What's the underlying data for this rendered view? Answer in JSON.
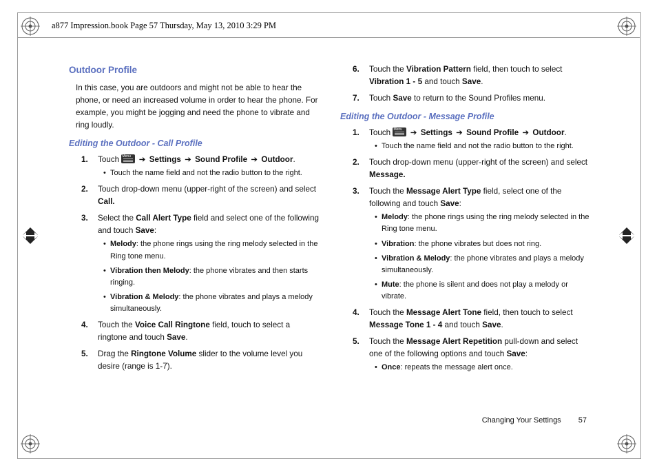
{
  "header": "a877 Impression.book  Page 57  Thursday, May 13, 2010  3:29 PM",
  "section_title": "Outdoor Profile",
  "intro": "In this case, you are outdoors and might not be able to hear the phone, or need an increased volume in order to hear the phone. For example, you might be jogging and need the phone to vibrate and ring loudly.",
  "sub1_title": "Editing the Outdoor - Call Profile",
  "sub2_title": "Editing the Outdoor - Message Profile",
  "nav_path": "Settings ➔ Sound Profile ➔ Outdoor",
  "arrow": "➔",
  "steps1": {
    "s1_a": "Touch ",
    "s1_b": "Settings",
    "s1_c": "Sound Profile",
    "s1_d": "Outdoor",
    "s1_note": "Touch the name field and not the radio button to the right.",
    "s2_a": "Touch drop-down menu (upper-right of the screen) and select ",
    "s2_b": "Call.",
    "s3_a": "Select the ",
    "s3_b": "Call Alert Type",
    "s3_c": " field and select one of the following and touch ",
    "s3_d": "Save",
    "s3_opts": {
      "o1a": "Melody",
      "o1b": ": the phone rings using the ring melody selected in the Ring tone menu.",
      "o2a": "Vibration then Melody",
      "o2b": ": the phone vibrates and then starts ringing.",
      "o3a": "Vibration & Melody",
      "o3b": ": the phone vibrates and plays a melody simultaneously."
    },
    "s4_a": "Touch the ",
    "s4_b": "Voice Call Ringtone",
    "s4_c": " field, touch to select a ringtone and touch ",
    "s4_d": "Save",
    "s5_a": "Drag the ",
    "s5_b": "Ringtone Volume",
    "s5_c": " slider to the volume level you desire (range is 1-7).",
    "s6_a": "Touch the ",
    "s6_b": "Vibration Pattern",
    "s6_c": " field, then touch to select ",
    "s6_d": "Vibration 1 - 5",
    "s6_e": " and touch ",
    "s6_f": "Save",
    "s7_a": "Touch ",
    "s7_b": "Save",
    "s7_c": " to return to the Sound Profiles menu."
  },
  "steps2": {
    "s1_a": "Touch ",
    "s1_note": "Touch the name field and not the radio button to the right.",
    "s2_a": "Touch drop-down menu (upper-right of the screen) and select ",
    "s2_b": "Message.",
    "s3_a": "Touch the ",
    "s3_b": "Message Alert Type",
    "s3_c": " field, select one of the following and touch ",
    "s3_d": "Save",
    "s3_opts": {
      "o1a": "Melody",
      "o1b": ": the phone rings using the ring melody selected in the Ring tone menu.",
      "o2a": "Vibration",
      "o2b": ": the phone vibrates but does not ring.",
      "o3a": "Vibration & Melody",
      "o3b": ": the phone vibrates and plays a melody simultaneously.",
      "o4a": "Mute",
      "o4b": ": the phone is silent and does not play a melody or vibrate."
    },
    "s4_a": "Touch the ",
    "s4_b": "Message Alert Tone",
    "s4_c": " field, then touch to select ",
    "s4_d": "Message Tone 1 - 4",
    "s4_e": " and touch ",
    "s4_f": "Save",
    "s5_a": "Touch the ",
    "s5_b": "Message Alert Repetition",
    "s5_c": " pull-down and select one of the following options and touch ",
    "s5_d": "Save",
    "s5_opts": {
      "o1a": "Once",
      "o1b": ": repeats the message alert once."
    }
  },
  "footer_label": "Changing Your Settings",
  "footer_page": "57"
}
